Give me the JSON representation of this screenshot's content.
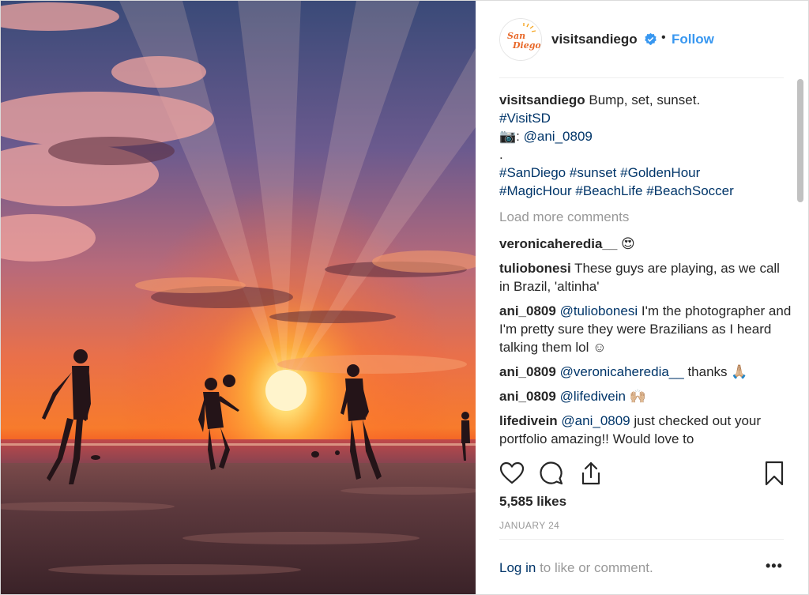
{
  "post": {
    "image_description_name": "beach-sunset-photo",
    "account": {
      "username": "visitsandiego",
      "avatar_logo_text": "SanDiego",
      "follow_label": "Follow",
      "separator": "•"
    },
    "caption": {
      "username": "visitsandiego",
      "text": "Bump, set, sunset.",
      "hashtag_visitsd": "#VisitSD",
      "camera_emoji": "📷",
      "credit_colon": ":",
      "credit_user": "@ani_0809",
      "dot_line": ".",
      "hashtags_line1": [
        "#SanDiego",
        "#sunset",
        "#GoldenHour"
      ],
      "hashtags_line2": [
        "#MagicHour",
        "#BeachLife",
        "#BeachSoccer"
      ]
    },
    "load_more_label": "Load more comments",
    "comments": [
      {
        "user": "veronicaheredia__",
        "mention": "",
        "text": "😍"
      },
      {
        "user": "tuliobonesi",
        "mention": "",
        "text": "These guys are playing, as we call in Brazil, 'altinha'"
      },
      {
        "user": "ani_0809",
        "mention": "@tuliobonesi",
        "text": "I'm the photographer and I'm pretty sure they were Brazilians as I heard talking them lol ☺"
      },
      {
        "user": "ani_0809",
        "mention": "@veronicaheredia__",
        "text": "thanks 🙏🏼"
      },
      {
        "user": "ani_0809",
        "mention": "@lifedivein",
        "text": "🙌🏼"
      },
      {
        "user": "lifedivein",
        "mention": "@ani_0809",
        "text": "just checked out your portfolio amazing!! Would love to"
      }
    ],
    "likes": "5,585 likes",
    "date": "JANUARY 24",
    "footer": {
      "login_link": "Log in",
      "login_rest": "to like or comment.",
      "more": "•••"
    },
    "icons": [
      "heart-icon",
      "comment-icon",
      "share-icon",
      "bookmark-icon",
      "verified-badge-icon"
    ],
    "colors": {
      "link_blue": "#3897f0",
      "hashtag_navy": "#003569",
      "muted_gray": "#999999",
      "verified_blue": "#3897f0"
    }
  }
}
